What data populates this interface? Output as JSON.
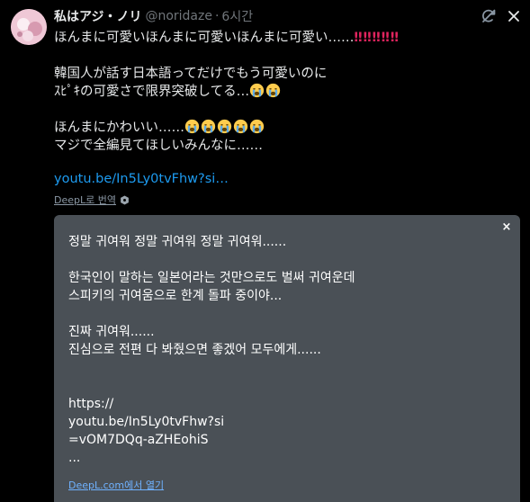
{
  "tweet": {
    "display_name": "私はアジ・ノリ",
    "handle": "@noridaze",
    "dot": "·",
    "time": "6시간",
    "lines": [
      "ほんまに可愛いほんまに可愛いほんまに可愛い……",
      "韓国人が話す日本語ってだけでもう可愛いのに",
      "ｽﾋﾟｷの可愛さで限界突破してる…",
      "ほんまにかわいい……",
      "マジで全編見てほしいみんなに……"
    ],
    "bangs": "‼‼‼‼‼",
    "link_text": "youtu.be/In5Ly0tvFhw?si…",
    "deepl_label": "DeepL로 번역"
  },
  "translation_panel": {
    "lines": [
      "정말 귀여워 정말 귀여워 정말 귀여워......",
      "한국인이 말하는 일본어라는 것만으로도 벌써 귀여운데",
      "스피키의 귀여움으로 한계 돌파 중이야...",
      "진짜 귀여워......",
      "진심으로 전편 다 봐줬으면 좋겠어 모두에게......",
      "https://",
      "youtu.be/In5Ly0tvFhw?si",
      "=vOM7DQq-aZHEohiS",
      "..."
    ],
    "close_label": "×",
    "footer_link": "DeepL.com에서 열기"
  },
  "icons": {
    "top_right_1": "translate-off-icon",
    "top_right_2": "close-icon",
    "emoji": "loudly-crying-face-emoji",
    "deepl_badge": "deepl-logo-icon"
  },
  "colors": {
    "link": "#1d9bf0",
    "bang": "#e0245e",
    "panel_bg": "#4a5056",
    "muted": "#71767b"
  }
}
